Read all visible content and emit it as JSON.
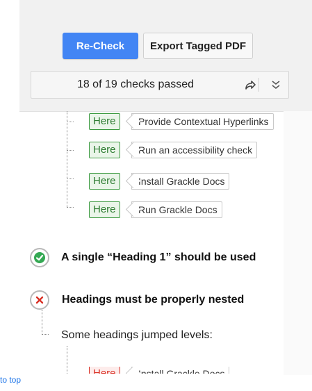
{
  "toolbar": {
    "recheck_label": "Re-Check",
    "export_label": "Export Tagged PDF"
  },
  "status": {
    "text": "18 of 19 checks passed",
    "icons": [
      "share-arrow-icon",
      "chevron-double-down-icon"
    ]
  },
  "hyperlink_list": [
    {
      "action": "Here",
      "label": "Provide Contextual Hyperlinks"
    },
    {
      "action": "Here",
      "label": "Run an accessibility check"
    },
    {
      "action": "Here",
      "label": "Install Grackle Docs"
    },
    {
      "action": "Here",
      "label": "Run Grackle Docs"
    }
  ],
  "checks": [
    {
      "status": "pass",
      "title": "A single “Heading 1” should be used"
    },
    {
      "status": "fail",
      "title": "Headings must be properly nested",
      "detail": "Some headings jumped levels:"
    }
  ],
  "partial_row": {
    "action": "Here",
    "label": "Install Grackle Docs"
  },
  "footer": {
    "to_top": "to top"
  },
  "colors": {
    "primary": "#4285f4",
    "pass": "#34a853",
    "fail": "#d93025"
  }
}
